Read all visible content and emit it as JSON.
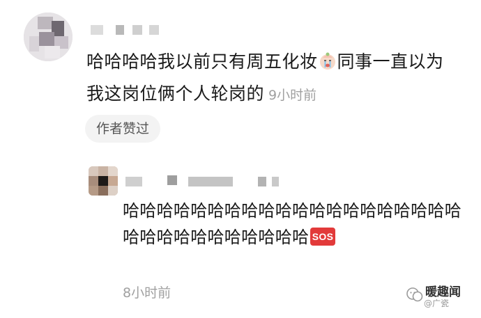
{
  "comment": {
    "text_before_emoji": "哈哈哈哈我以前只有周五化妆",
    "emoji": "crying-face-emoji",
    "text_after_emoji": "同事一直以为我这岗位俩个人轮岗的",
    "time": "9小时前",
    "author_liked_label": "作者赞过"
  },
  "reply": {
    "text": "哈哈哈哈哈哈哈哈哈哈哈哈哈哈哈哈哈哈哈哈哈哈哈哈哈哈哈哈哈哈哈",
    "emoji": "sos-emoji",
    "emoji_text": "SOS",
    "time": "8小时前"
  },
  "watermark": {
    "brand": "暖趣闻",
    "handle": "@广瓷"
  },
  "colors": {
    "time_text": "#a0a0a0",
    "chip_bg": "#f3f3f3",
    "sos_red": "#e23a3a"
  }
}
